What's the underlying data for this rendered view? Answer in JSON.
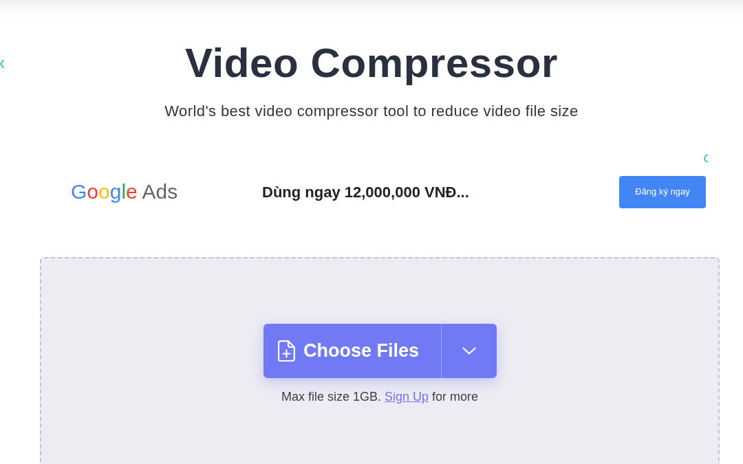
{
  "title": "Video Compressor",
  "subtitle": "World's best video compressor tool to reduce video file size",
  "ad": {
    "brand": "Google Ads",
    "headline": "Dùng ngay 12,000,000 VNĐ...",
    "button": "Đăng ký ngay"
  },
  "upload": {
    "button": "Choose Files",
    "note": {
      "before": "Max file size 1GB.",
      "link": "Sign Up",
      "after": "for more"
    }
  }
}
